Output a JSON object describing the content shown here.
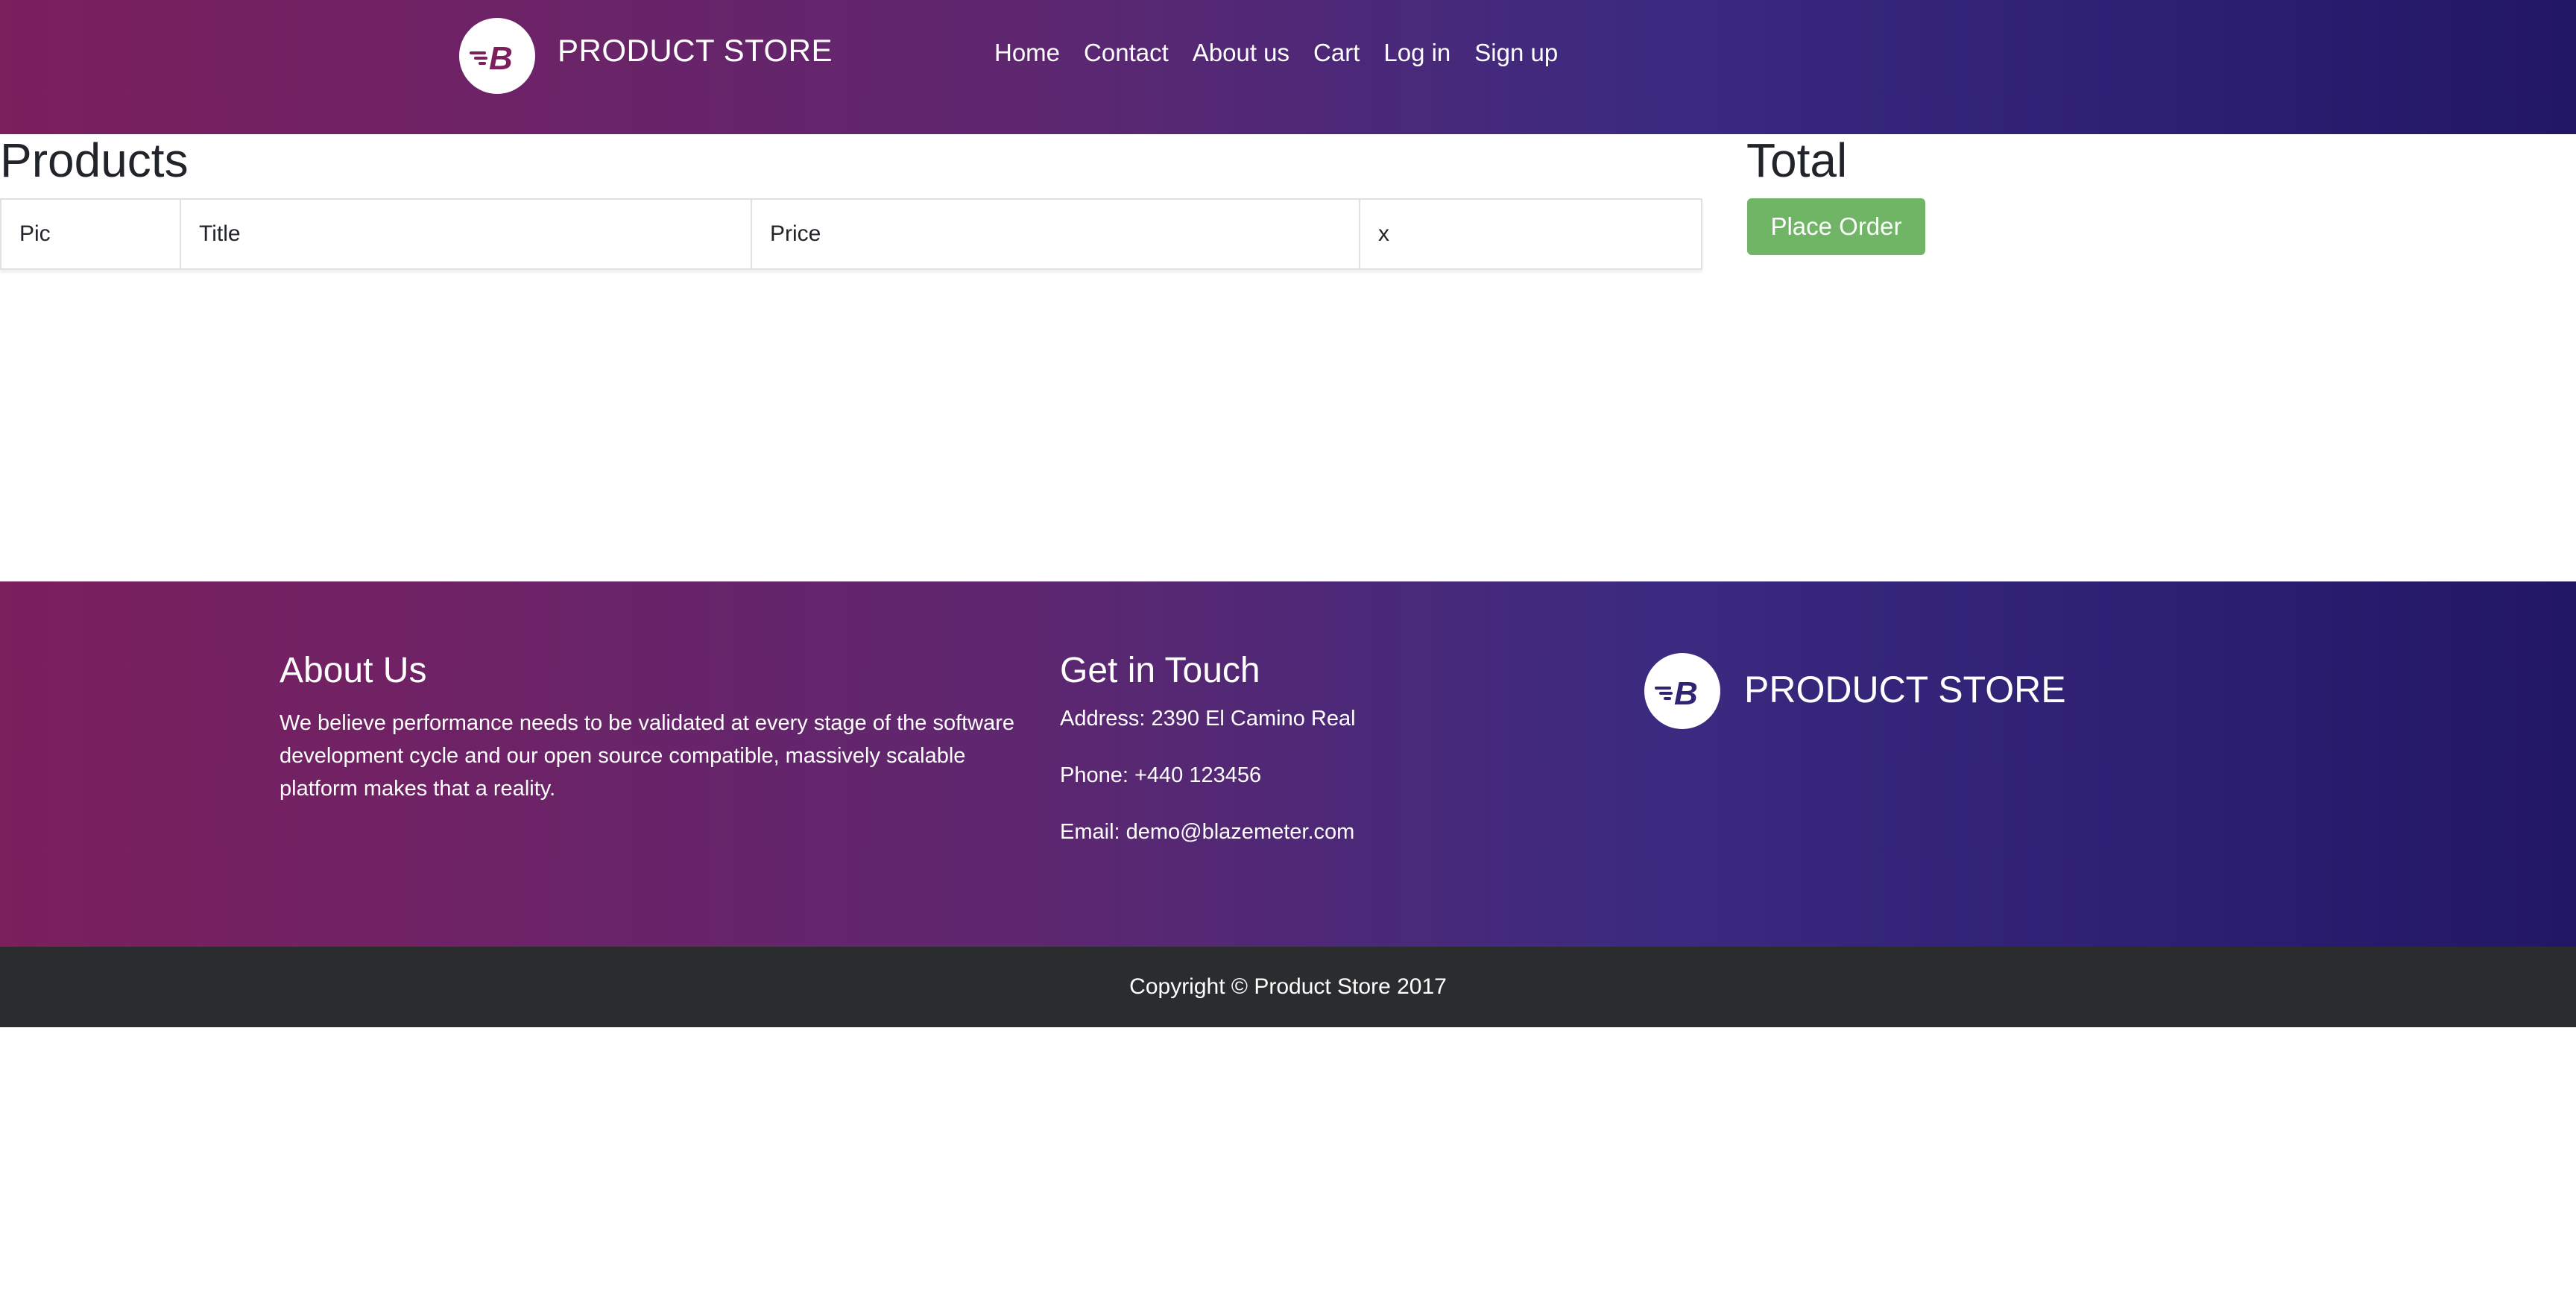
{
  "navbar": {
    "logo_icon": "blazemeter-b-icon",
    "brand": "PRODUCT STORE",
    "links": [
      "Home",
      "Contact",
      "About us",
      "Cart",
      "Log in",
      "Sign up"
    ]
  },
  "main": {
    "products_title": "Products",
    "table_headers": [
      "Pic",
      "Title",
      "Price",
      "x"
    ],
    "total_title": "Total",
    "place_order_label": "Place Order"
  },
  "footer": {
    "about_heading": "About Us",
    "about_text": "We believe performance needs to be validated at every stage of the software development cycle and our open source compatible, massively scalable platform makes that a reality.",
    "touch_heading": "Get in Touch",
    "address": "Address: 2390 El Camino Real",
    "phone": "Phone: +440 123456",
    "email": "Email: demo@blazemeter.com",
    "brand": "PRODUCT STORE",
    "copyright": "Copyright © Product Store 2017"
  },
  "colors": {
    "gradient_start": "#7b1f5d",
    "gradient_end": "#221666",
    "place_order_bg": "#6fb565",
    "copyright_bg": "#2a2c2e"
  }
}
